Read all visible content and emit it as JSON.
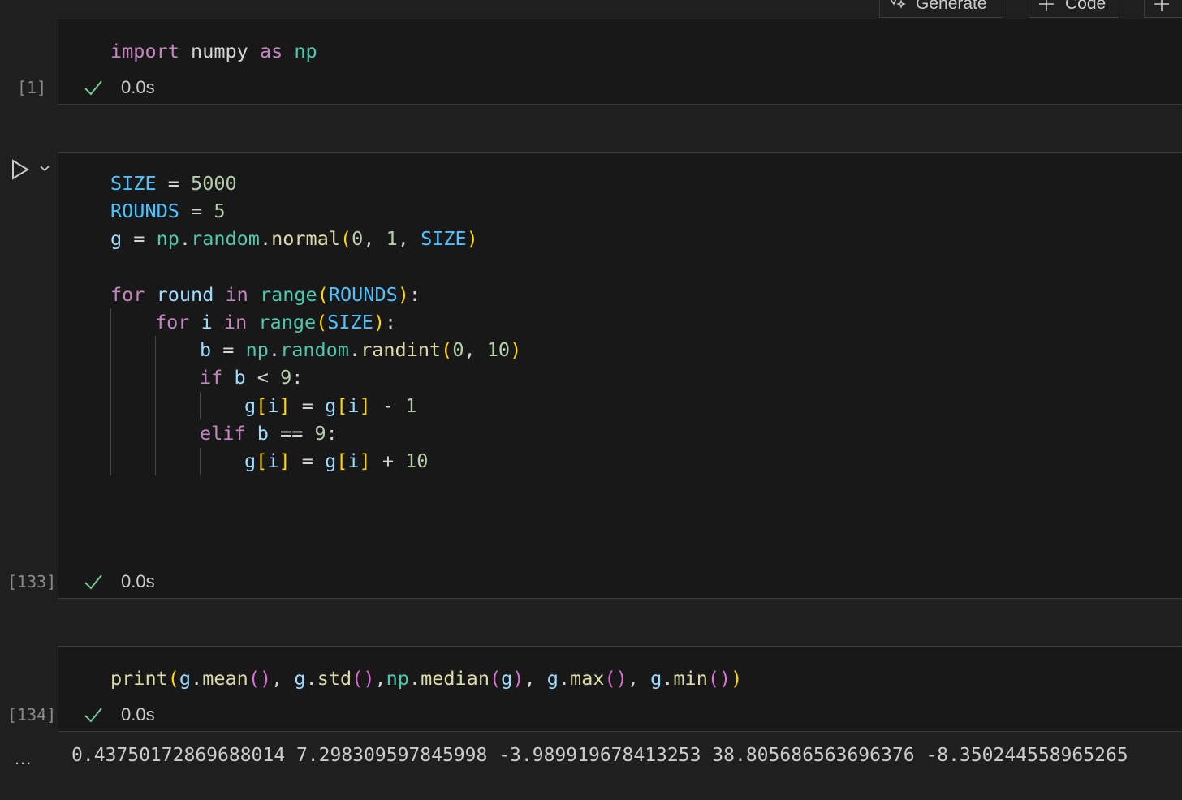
{
  "toolbar": {
    "generate_label": "Generate",
    "code_label": "Code"
  },
  "cells": [
    {
      "exec_count": "[1]",
      "time": "0.0s"
    },
    {
      "exec_count": "[133]",
      "time": "0.0s"
    },
    {
      "exec_count": "[134]",
      "time": "0.0s",
      "output_menu": "...",
      "output": "0.43750172869688014 7.298309597845998 -3.989919678413253 38.805686563696376 -8.350244558965265"
    }
  ],
  "code": {
    "cell1": {
      "line1": [
        "import",
        " ",
        "numpy",
        " ",
        "as",
        " ",
        "np"
      ]
    },
    "cell2": {
      "line1": [
        "SIZE",
        " = ",
        "5000"
      ],
      "line2": [
        "ROUNDS",
        " = ",
        "5"
      ],
      "line3": [
        "g",
        " = ",
        "np",
        ".",
        "random",
        ".",
        "normal",
        "(",
        "0",
        ", ",
        "1",
        ", ",
        "SIZE",
        ")"
      ],
      "line5": [
        "for",
        " ",
        "round",
        " ",
        "in",
        " ",
        "range",
        "(",
        "ROUNDS",
        ")",
        ":"
      ],
      "line6": [
        "for",
        " ",
        "i",
        " ",
        "in",
        " ",
        "range",
        "(",
        "SIZE",
        ")",
        ":"
      ],
      "line7": [
        "b",
        " = ",
        "np",
        ".",
        "random",
        ".",
        "randint",
        "(",
        "0",
        ", ",
        "10",
        ")"
      ],
      "line8": [
        "if",
        " ",
        "b",
        " < ",
        "9",
        ":"
      ],
      "line9": [
        "g",
        "[",
        "i",
        "]",
        " = ",
        "g",
        "[",
        "i",
        "]",
        " - ",
        "1"
      ],
      "line10": [
        "elif",
        " ",
        "b",
        " == ",
        "9",
        ":"
      ],
      "line11": [
        "g",
        "[",
        "i",
        "]",
        " = ",
        "g",
        "[",
        "i",
        "]",
        " + ",
        "10"
      ]
    },
    "cell3": {
      "line1": [
        "print",
        "(",
        "g",
        ".",
        "mean",
        "()",
        ", ",
        "g",
        ".",
        "std",
        "()",
        ",",
        "np",
        ".",
        "median",
        "(",
        "g",
        ")",
        ", ",
        "g",
        ".",
        "max",
        "()",
        ", ",
        "g",
        ".",
        "min",
        "()",
        ")"
      ]
    }
  },
  "colors": {
    "keyword": "#c586c0",
    "variable": "#9cdcfe",
    "constant": "#4fc1ff",
    "number": "#b5cea8",
    "function": "#dcdcaa",
    "module": "#4ec9b0",
    "success_check": "#73c991",
    "cell_background": "#181818",
    "page_background": "#1f1f1f"
  },
  "icons": {
    "run": "play-icon",
    "collapse": "chevron-down-icon",
    "success": "check-icon",
    "generate": "sparkle-icon",
    "add": "plus-icon"
  }
}
